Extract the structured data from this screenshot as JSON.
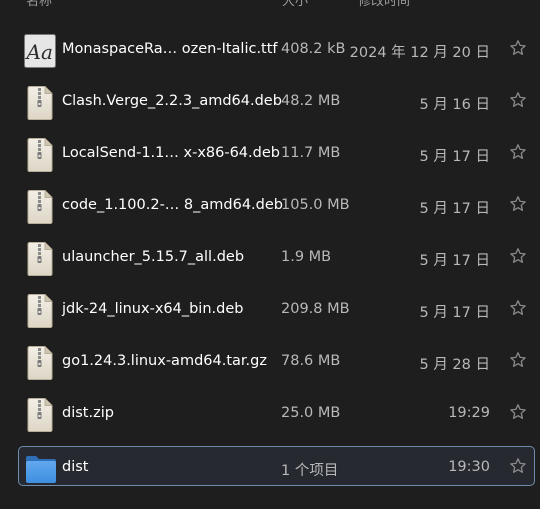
{
  "header": {
    "name_label": "名称",
    "size_label": "大小",
    "modified_label": "修改时间"
  },
  "files": [
    {
      "name": "MonaspaceRa…  ozen-Italic.ttf",
      "size": "408.2 kB",
      "modified": "2024 年 12 月 20 日",
      "icon": "font-file-icon",
      "selected": false
    },
    {
      "name": "Clash.Verge_2.2.3_amd64.deb",
      "size": "48.2 MB",
      "modified": "5 月 16 日",
      "icon": "package-file-icon",
      "selected": false
    },
    {
      "name": "LocalSend-1.1…  x-x86-64.deb",
      "size": "11.7 MB",
      "modified": "5 月 17 日",
      "icon": "package-file-icon",
      "selected": false
    },
    {
      "name": "code_1.100.2-…  8_amd64.deb",
      "size": "105.0 MB",
      "modified": "5 月 17 日",
      "icon": "package-file-icon",
      "selected": false
    },
    {
      "name": "ulauncher_5.15.7_all.deb",
      "size": "1.9 MB",
      "modified": "5 月 17 日",
      "icon": "package-file-icon",
      "selected": false
    },
    {
      "name": "jdk-24_linux-x64_bin.deb",
      "size": "209.8 MB",
      "modified": "5 月 17 日",
      "icon": "package-file-icon",
      "selected": false
    },
    {
      "name": "go1.24.3.linux-amd64.tar.gz",
      "size": "78.6 MB",
      "modified": "5 月 28 日",
      "icon": "archive-file-icon",
      "selected": false
    },
    {
      "name": "dist.zip",
      "size": "25.0 MB",
      "modified": "19:29",
      "icon": "archive-file-icon",
      "selected": false
    },
    {
      "name": "dist",
      "size": "1 个项目",
      "modified": "19:30",
      "icon": "folder-icon",
      "selected": true
    }
  ],
  "colors": {
    "background": "#1e1e1e",
    "selection_border": "#6e8cae",
    "folder_blue": "#3d8fe0"
  }
}
